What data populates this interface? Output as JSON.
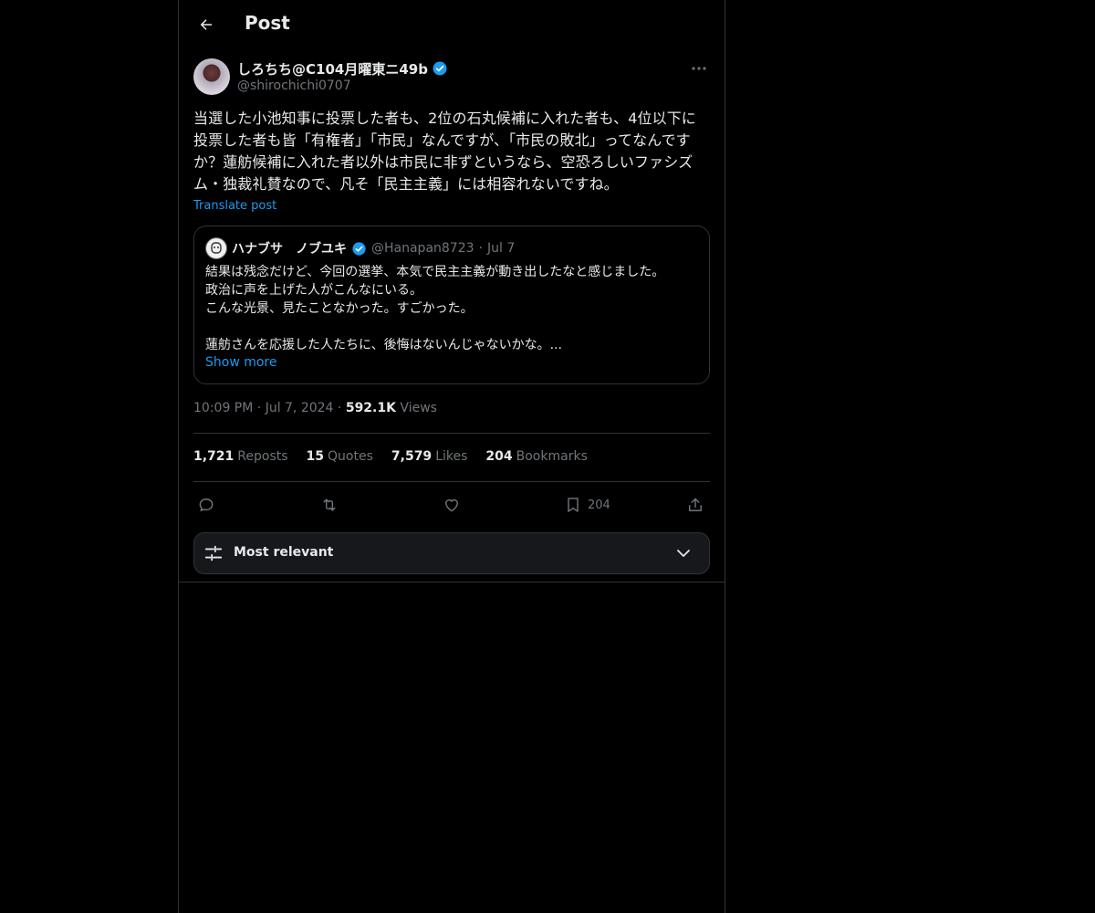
{
  "header": {
    "title": "Post"
  },
  "post": {
    "display_name": "しろちち@C104月曜東ニ49b",
    "handle": "@shirochichi0707",
    "text": "当選した小池知事に投票した者も、2位の石丸候補に入れた者も、4位以下に投票した者も皆「有権者」「市民」なんですが、「市民の敗北」ってなんですか？蓮舫候補に入れた者以外は市民に非ずというなら、空恐ろしいファシズム・独裁礼賛なので、凡そ「民主主義」には相容れないですね。",
    "translate_label": "Translate post",
    "time": "10:09 PM",
    "date": "Jul 7, 2024",
    "views_count": "592.1K",
    "views_label": "Views"
  },
  "quote": {
    "display_name": "ハナブサ　ノブユキ",
    "handle": "@Hanapan8723",
    "date": "Jul 7",
    "lines": [
      "結果は残念だけど、今回の選挙、本気で民主主義が動き出したなと感じました。",
      "政治に声を上げた人がこんなにいる。",
      "こんな光景、見たことなかった。すごかった。",
      "",
      "蓮舫さんを応援した人たちに、後悔はないんじゃないかな。..."
    ],
    "show_more": "Show more"
  },
  "stats": {
    "reposts_count": "1,721",
    "reposts_label": "Reposts",
    "quotes_count": "15",
    "quotes_label": "Quotes",
    "likes_count": "7,579",
    "likes_label": "Likes",
    "bookmarks_count": "204",
    "bookmarks_label": "Bookmarks"
  },
  "actions": {
    "bookmark_count": "204"
  },
  "sort": {
    "label": "Most relevant"
  },
  "colors": {
    "background": "#000000",
    "text": "#e7e9ea",
    "muted": "#71767b",
    "accent": "#1d9bf0",
    "border": "#2f3336"
  },
  "icons": [
    "back-arrow-icon",
    "verified-badge-icon",
    "more-dots-icon",
    "reply-icon",
    "repost-icon",
    "like-icon",
    "bookmark-icon",
    "share-icon",
    "sliders-icon",
    "chevron-down-icon"
  ]
}
